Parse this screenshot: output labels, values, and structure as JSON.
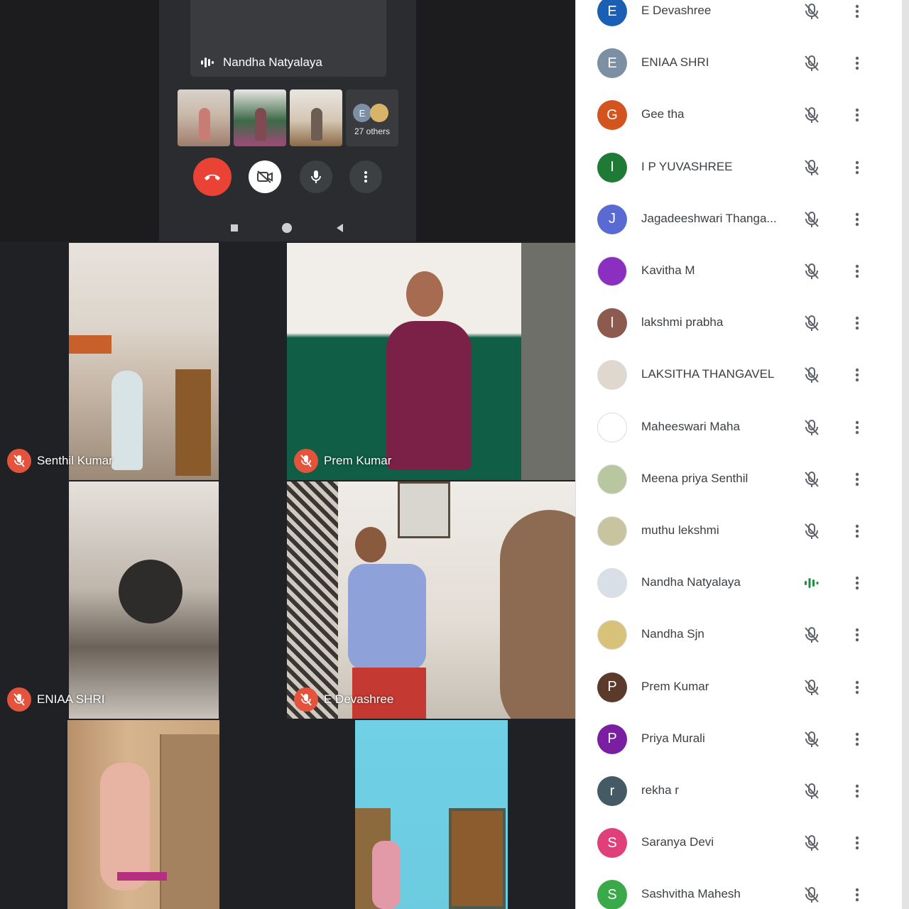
{
  "presenter": {
    "name": "Nandha Natyalaya"
  },
  "thumbnails": {
    "others_initial": "E",
    "others_label": "27 others"
  },
  "tiles": [
    {
      "name": "Senthil Kumar",
      "muted": true
    },
    {
      "name": "Prem Kumar",
      "muted": true
    },
    {
      "name": "ENIAA SHRI",
      "muted": true
    },
    {
      "name": "E Devashree",
      "muted": true
    }
  ],
  "colors": {
    "hangup": "#ea4335",
    "mute_badge": "#e4543d",
    "speaking": "#1e8e3e"
  },
  "participants": [
    {
      "name": "E Devashree",
      "initial": "E",
      "color": "#1a5fb4",
      "mic": "muted"
    },
    {
      "name": "ENIAA SHRI",
      "initial": "E",
      "color": "#7d8fa3",
      "mic": "muted"
    },
    {
      "name": "Gee tha",
      "initial": "G",
      "color": "#d4541f",
      "mic": "muted"
    },
    {
      "name": "I P YUVASHREE",
      "initial": "I",
      "color": "#1e7a34",
      "mic": "muted"
    },
    {
      "name": "Jagadeeshwari Thanga...",
      "initial": "J",
      "color": "#5a6ad3",
      "mic": "muted"
    },
    {
      "name": "Kavitha M",
      "initial": "",
      "color": "#8a2fbf",
      "mic": "muted"
    },
    {
      "name": "lakshmi prabha",
      "initial": "l",
      "color": "#8d5a4f",
      "mic": "muted"
    },
    {
      "name": "LAKSITHA THANGAVEL",
      "initial": "",
      "color": "#e0d8cf",
      "mic": "muted"
    },
    {
      "name": "Maheeswari Maha",
      "initial": "",
      "color": "#ffffff",
      "mic": "muted"
    },
    {
      "name": "Meena priya Senthil",
      "initial": "",
      "color": "#b9c7a0",
      "mic": "muted"
    },
    {
      "name": "muthu lekshmi",
      "initial": "",
      "color": "#c9c4a0",
      "mic": "muted"
    },
    {
      "name": "Nandha Natyalaya",
      "initial": "",
      "color": "#d9dfe6",
      "mic": "speaking"
    },
    {
      "name": "Nandha Sjn",
      "initial": "",
      "color": "#d8c27a",
      "mic": "muted"
    },
    {
      "name": "Prem Kumar",
      "initial": "P",
      "color": "#5b3a2c",
      "mic": "muted"
    },
    {
      "name": "Priya Murali",
      "initial": "P",
      "color": "#7b1fa2",
      "mic": "muted"
    },
    {
      "name": "rekha r",
      "initial": "r",
      "color": "#455a64",
      "mic": "muted"
    },
    {
      "name": "Saranya Devi",
      "initial": "S",
      "color": "#e0407a",
      "mic": "muted"
    },
    {
      "name": "Sashvitha Mahesh",
      "initial": "S",
      "color": "#3aa94a",
      "mic": "muted"
    }
  ]
}
